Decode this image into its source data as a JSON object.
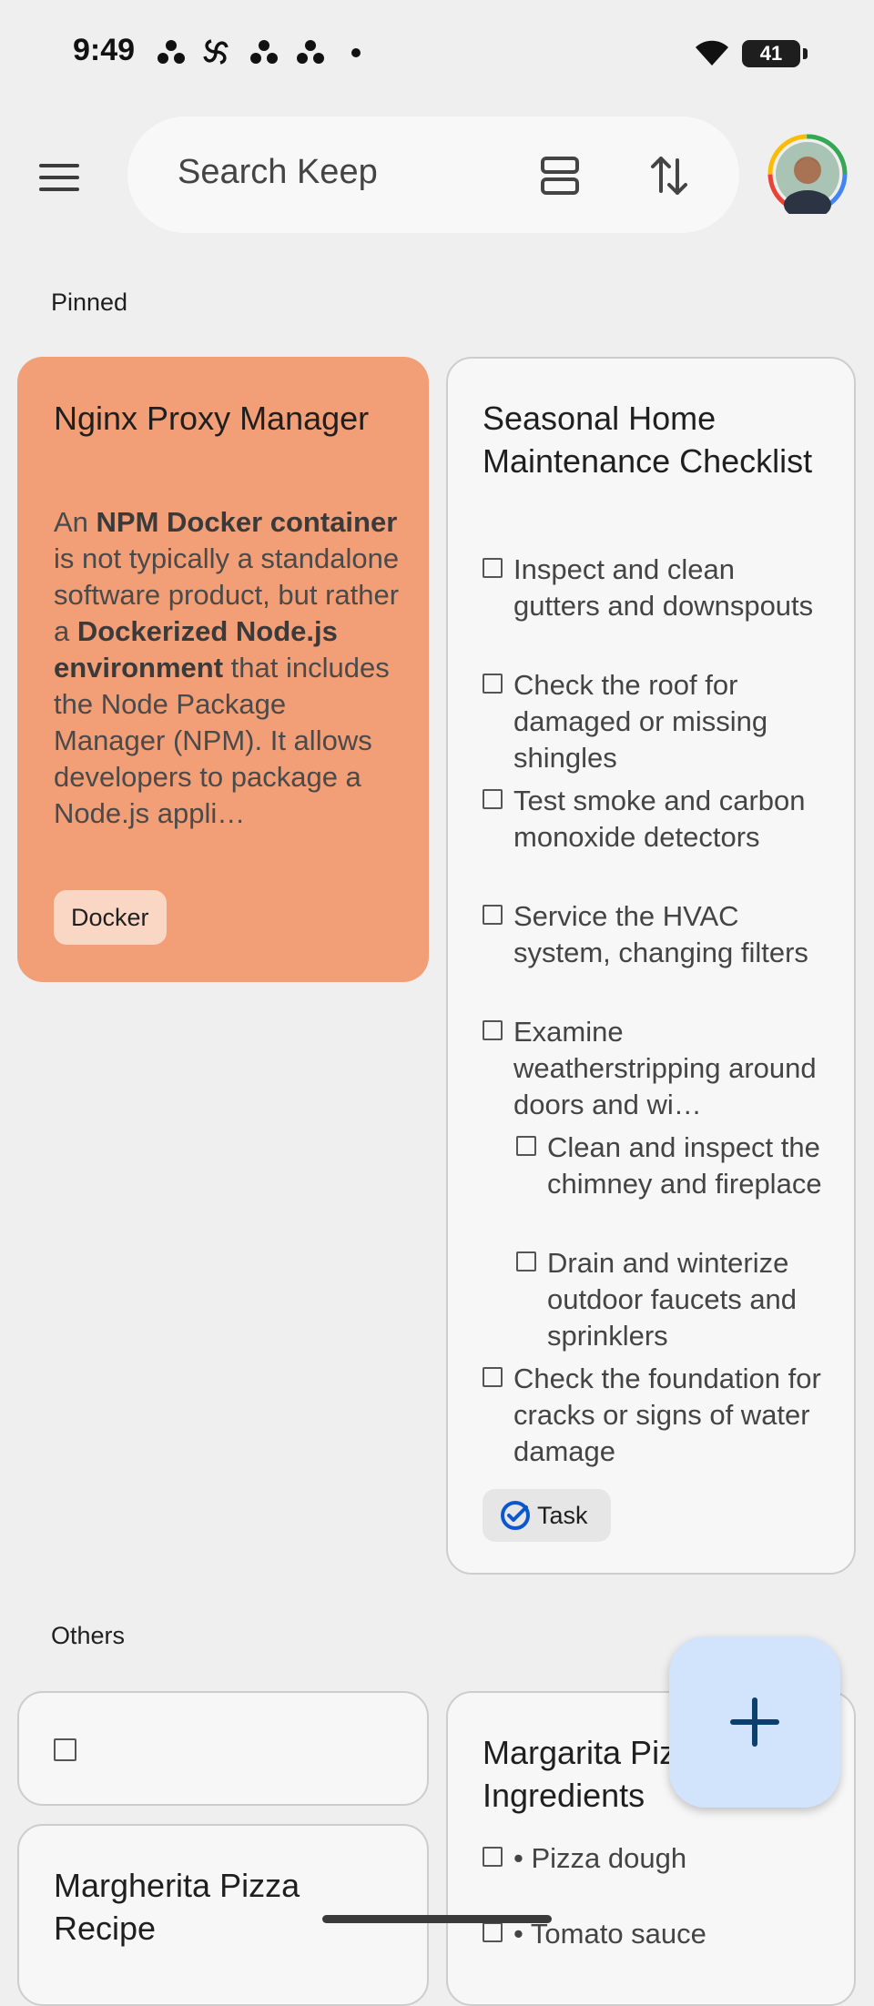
{
  "status_bar": {
    "time": "9:49",
    "battery": "41"
  },
  "search": {
    "placeholder": "Search Keep"
  },
  "sections": {
    "pinned": "Pinned",
    "others": "Others"
  },
  "pinned_notes": {
    "nginx": {
      "title": "Nginx Proxy Manager",
      "body_parts": [
        {
          "text": "An ",
          "bold": false
        },
        {
          "text": "NPM Docker container",
          "bold": true
        },
        {
          "text": " is not typically a standalone software product, but rather a ",
          "bold": false
        },
        {
          "text": "Dockerized Node.js environment",
          "bold": true
        },
        {
          "text": " that includes the Node Package Manager (NPM). It allows developers to package a Node.js appli…",
          "bold": false
        }
      ],
      "label": "Docker",
      "color": "#f29e76"
    },
    "seasonal": {
      "title": "Seasonal Home Maintenance Checklist",
      "items": [
        {
          "text": "Inspect and clean gutters and downspouts",
          "checked": false,
          "indent": 0
        },
        {
          "text": "Check the roof for damaged or missing shingles",
          "checked": false,
          "indent": 0
        },
        {
          "text": "Test smoke and carbon monoxide detectors",
          "checked": false,
          "indent": 0
        },
        {
          "text": "Service the HVAC system, changing filters",
          "checked": false,
          "indent": 0
        },
        {
          "text": "Examine weatherstripping around doors and wi…",
          "checked": false,
          "indent": 0
        },
        {
          "text": "Clean and inspect the chimney and fireplace",
          "checked": false,
          "indent": 1
        },
        {
          "text": "Drain and winterize outdoor faucets and sprinklers",
          "checked": false,
          "indent": 1
        },
        {
          "text": "Check the foundation for cracks or signs of water damage",
          "checked": false,
          "indent": 0
        }
      ],
      "label": "Task"
    }
  },
  "other_notes": {
    "empty_checklist": {
      "items": [
        {
          "text": "",
          "checked": false
        }
      ]
    },
    "margherita": {
      "title": "Margherita Pizza Recipe"
    },
    "margarita": {
      "title": "Margarita Pizza Ingredients",
      "items": [
        {
          "text": "• Pizza dough",
          "checked": false
        },
        {
          "text": "• Tomato sauce",
          "checked": false
        }
      ]
    }
  },
  "fab": {
    "icon": "plus-icon"
  },
  "colors": {
    "background": "#efefef",
    "accent": "#0b57d0",
    "fab": "#d2e4fb",
    "nginx_card": "#f29e76"
  }
}
